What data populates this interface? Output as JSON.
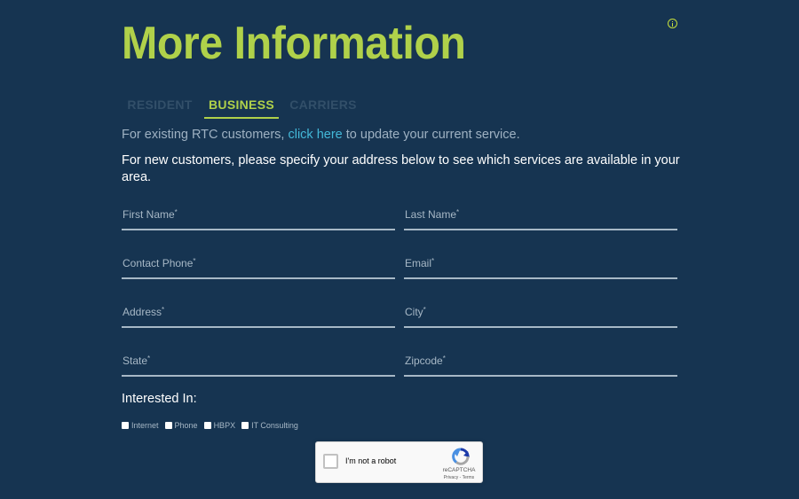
{
  "page": {
    "title": "More Information"
  },
  "tabs": [
    {
      "label": "RESIDENT",
      "active": false
    },
    {
      "label": "BUSINESS",
      "active": true
    },
    {
      "label": "CARRIERS",
      "active": false
    }
  ],
  "intro": {
    "existing_prefix": "For existing RTC customers, ",
    "existing_link": "click here",
    "existing_suffix": " to update your current service.",
    "new_text": "For new customers, please specify your address below to see which services are available in your area."
  },
  "form": {
    "required_marker": "*",
    "fields": [
      {
        "label": "First Name",
        "value": ""
      },
      {
        "label": "Last Name",
        "value": ""
      },
      {
        "label": "Contact Phone",
        "value": ""
      },
      {
        "label": "Email",
        "value": ""
      },
      {
        "label": "Address",
        "value": ""
      },
      {
        "label": "City",
        "value": ""
      },
      {
        "label": "State",
        "value": ""
      },
      {
        "label": "Zipcode",
        "value": ""
      }
    ],
    "interested_label": "Interested In:",
    "interests": [
      {
        "label": "Internet",
        "checked": false
      },
      {
        "label": "Phone",
        "checked": false
      },
      {
        "label": "HBPX",
        "checked": false
      },
      {
        "label": "IT Consulting",
        "checked": false
      }
    ]
  },
  "recaptcha": {
    "label": "I'm not a robot",
    "brand": "reCAPTCHA",
    "privacy": "Privacy",
    "separator": " - ",
    "terms": "Terms"
  },
  "icons": {
    "info": "info-icon",
    "recaptcha": "recaptcha-logo-icon"
  },
  "colors": {
    "background": "#163451",
    "accent": "#b0d14a",
    "link": "#43b8d8",
    "muted_text": "#9eb1c2",
    "field_line": "#a7b8c6",
    "inactive_tab": "#324f69"
  }
}
